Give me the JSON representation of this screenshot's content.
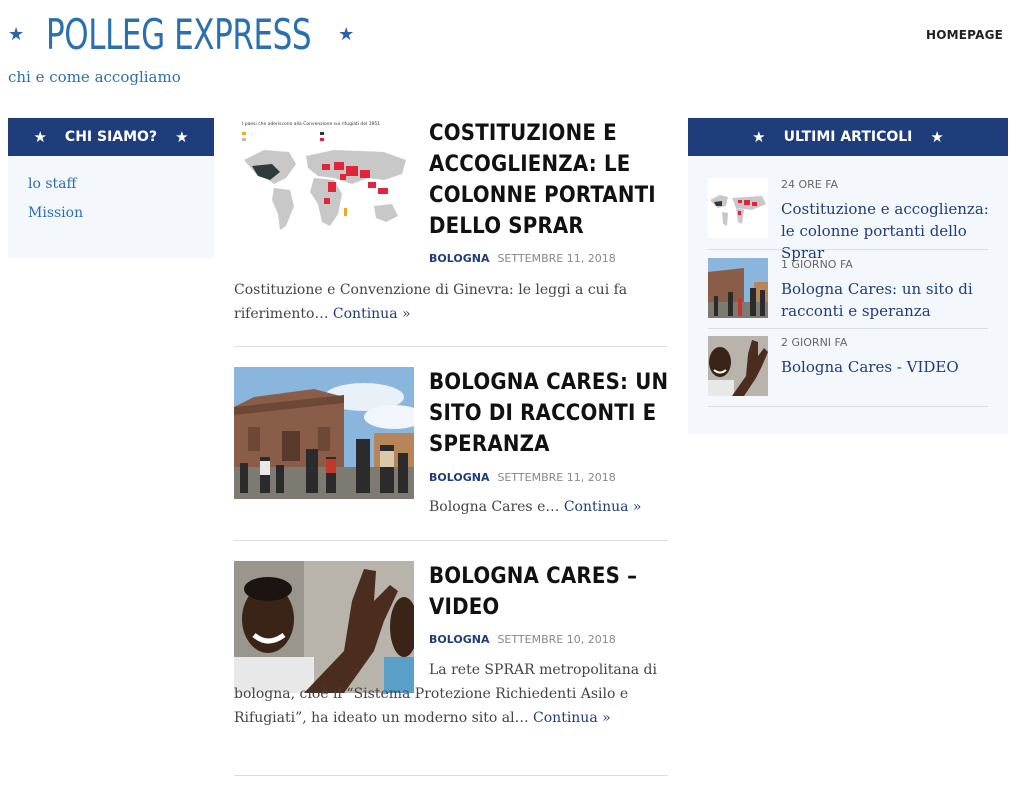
{
  "site": {
    "title": "POLLEG EXPRESS",
    "tagline": "chi e come accogliamo"
  },
  "nav": {
    "home": "HOMEPAGE"
  },
  "left_widget": {
    "title": "CHI SIAMO?",
    "links": [
      "lo staff",
      "Mission"
    ]
  },
  "right_widget": {
    "title": "ULTIMI ARTICOLI",
    "items": [
      {
        "time": "24 ORE FA",
        "title": "Costituzione e accoglienza: le colonne portanti dello Sprar"
      },
      {
        "time": "1 GIORNO FA",
        "title": "Bologna Cares: un sito di racconti e speranza"
      },
      {
        "time": "2 GIORNI FA",
        "title": "Bologna Cares - VIDEO"
      }
    ]
  },
  "posts": [
    {
      "title": "COSTITUZIONE E ACCOGLIENZA: LE COLONNE PORTANTI DELLO SPRAR",
      "category": "BOLOGNA",
      "date": "SETTEMBRE 11, 2018",
      "excerpt": "Costituzione e Convenzione di Ginevra: le leggi a cui fa riferimento…",
      "more": "Continua »",
      "image_text": "I paesi che aderiscono alla Convenzione sui rifugiati del 1951"
    },
    {
      "title": "BOLOGNA CARES: UN SITO DI RACCONTI E SPERANZA",
      "category": "BOLOGNA",
      "date": "SETTEMBRE 11, 2018",
      "excerpt": "Bologna Cares e…",
      "more": "Continua »"
    },
    {
      "title": "BOLOGNA CARES – VIDEO",
      "category": "BOLOGNA",
      "date": "SETTEMBRE 10, 2018",
      "excerpt": "La rete SPRAR metropolitana di bologna, cioè il “Sistema Protezione Richiedenti Asilo e Rifugiati”, ha ideato un moderno sito al…",
      "more": "Continua »"
    }
  ],
  "colors": {
    "brand": "#2a6fb0",
    "navy": "#1e3d7a",
    "widget_bg": "#f4f7fc"
  }
}
